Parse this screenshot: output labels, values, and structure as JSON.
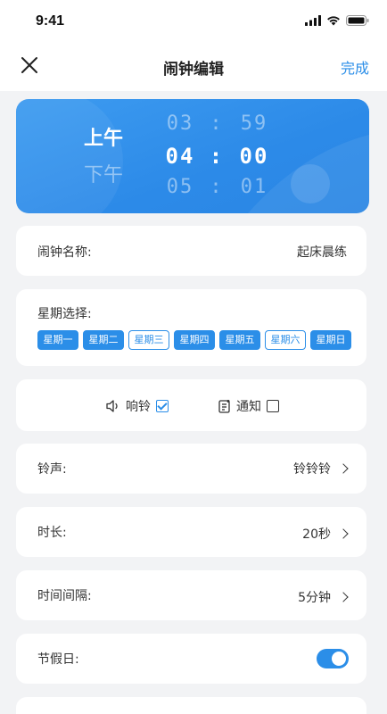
{
  "status_bar": {
    "time": "9:41"
  },
  "nav": {
    "title": "闹钟编辑",
    "done_label": "完成"
  },
  "time_picker": {
    "am_label": "上午",
    "pm_label": "下午",
    "selected_period": "上午",
    "rows": [
      {
        "hour": "03",
        "minute": "59"
      },
      {
        "hour": "04",
        "minute": "00"
      },
      {
        "hour": "05",
        "minute": "01"
      }
    ],
    "separator": ":",
    "selected_index": 1
  },
  "alarm_name": {
    "label": "闹钟名称:",
    "value": "起床晨练"
  },
  "weekdays": {
    "label": "星期选择:",
    "days": [
      {
        "label": "星期一",
        "selected": true
      },
      {
        "label": "星期二",
        "selected": true
      },
      {
        "label": "星期三",
        "selected": false
      },
      {
        "label": "星期四",
        "selected": true
      },
      {
        "label": "星期五",
        "selected": true
      },
      {
        "label": "星期六",
        "selected": false
      },
      {
        "label": "星期日",
        "selected": true
      }
    ]
  },
  "options": {
    "ring": {
      "label": "响铃",
      "checked": true,
      "icon": "speaker-icon"
    },
    "notify": {
      "label": "通知",
      "checked": false,
      "icon": "notification-icon"
    }
  },
  "ringtone": {
    "label": "铃声:",
    "value": "铃铃铃"
  },
  "duration": {
    "label": "时长:",
    "value": "20秒"
  },
  "interval": {
    "label": "时间间隔:",
    "value": "5分钟"
  },
  "holiday": {
    "label": "节假日:",
    "enabled": true
  },
  "colors": {
    "accent": "#2b8ee8",
    "background": "#f2f3f5",
    "card": "#ffffff"
  }
}
